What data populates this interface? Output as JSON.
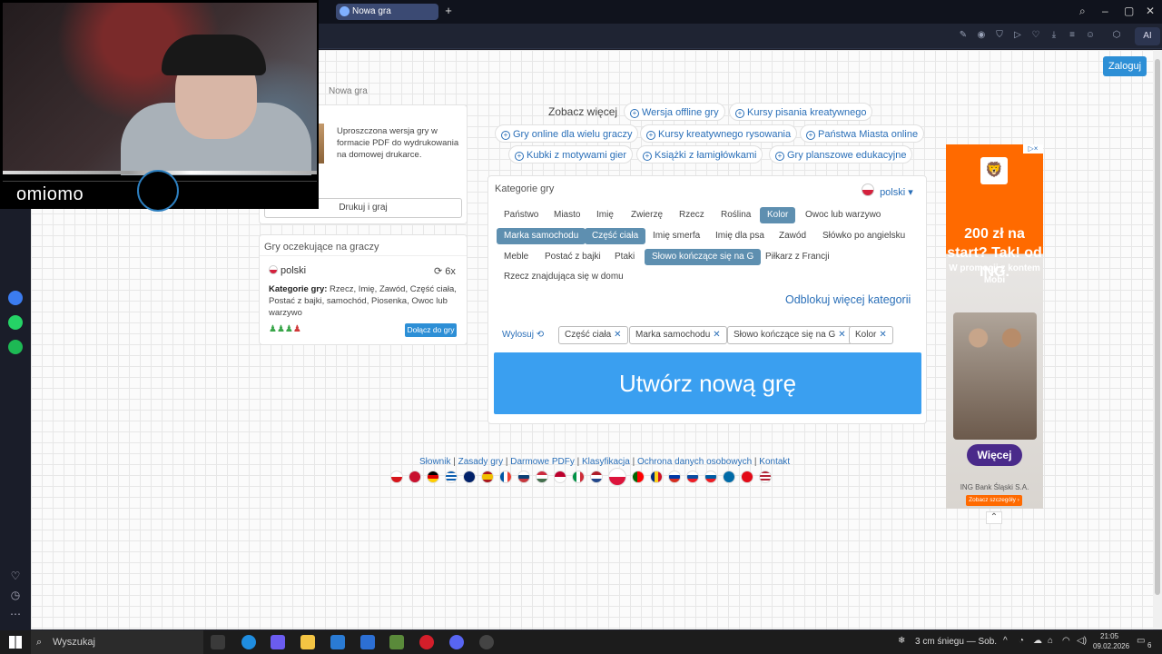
{
  "browser": {
    "tab_title": "Nowa gra",
    "newtab_symbol": "+",
    "ai_label": "AI"
  },
  "page": {
    "login_label": "Zaloguj",
    "breadcrumb": "Nowa gra",
    "print_card": {
      "text": "Uproszczona wersja gry w formacie PDF do wydrukowania na domowej drukarce.",
      "button": "Drukuj i graj"
    },
    "waiting_card": {
      "title": "Gry oczekujące na graczy",
      "language": "polski",
      "count": "6x",
      "categories_label": "Kategorie gry:",
      "categories": "Rzecz, Imię, Zawód, Część ciała, Postać z bajki, samochód, Piosenka, Owoc lub warzywo",
      "join_button": "Dołącz do gry"
    },
    "see_more_label": "Zobacz więcej",
    "links": [
      "Wersja offline gry",
      "Kursy pisania kreatywnego",
      "Gry online dla wielu graczy",
      "Kursy kreatywnego rysowania",
      "Państwa Miasta online",
      "Kubki z motywami gier",
      "Książki z łamigłówkami",
      "Gry planszowe edukacyjne"
    ],
    "categories_panel": {
      "title": "Kategorie gry",
      "language": "polski",
      "chips": [
        {
          "label": "Państwo",
          "selected": false
        },
        {
          "label": "Miasto",
          "selected": false
        },
        {
          "label": "Imię",
          "selected": false
        },
        {
          "label": "Zwierzę",
          "selected": false
        },
        {
          "label": "Rzecz",
          "selected": false
        },
        {
          "label": "Roślina",
          "selected": false
        },
        {
          "label": "Kolor",
          "selected": true
        },
        {
          "label": "Owoc lub warzywo",
          "selected": false
        },
        {
          "label": "Marka samochodu",
          "selected": true
        },
        {
          "label": "Część ciała",
          "selected": true
        },
        {
          "label": "Imię smerfa",
          "selected": false
        },
        {
          "label": "Imię dla psa",
          "selected": false
        },
        {
          "label": "Zawód",
          "selected": false
        },
        {
          "label": "Słówko po angielsku",
          "selected": false
        },
        {
          "label": "Meble",
          "selected": false
        },
        {
          "label": "Postać z bajki",
          "selected": false
        },
        {
          "label": "Ptaki",
          "selected": false
        },
        {
          "label": "Słowo kończące się na G",
          "selected": true
        },
        {
          "label": "Piłkarz z Francji",
          "selected": false
        },
        {
          "label": "Rzecz znajdująca się w domu",
          "selected": false
        }
      ],
      "unlock_label": "Odblokuj więcej kategorii",
      "draw_label": "Wylosuj",
      "selected_tags": [
        "Część ciała",
        "Marka samochodu",
        "Słowo kończące się na G",
        "Kolor"
      ],
      "create_button": "Utwórz nową grę"
    },
    "footer_links": [
      "Słownik",
      "Zasady gry",
      "Darmowe PDFy",
      "Klasyfikacja",
      "Ochrona danych osobowych",
      "Kontakt"
    ]
  },
  "ad": {
    "badge": "▷×",
    "headline": "200 zł na start? Tak! od ING.",
    "subtext": "W promocji z kontem Mobi",
    "more_button": "Więcej",
    "bank": "ING Bank Śląski S.A.",
    "details": "Zobacz szczegóły ›"
  },
  "overlay": {
    "streamer_name": "omiomo"
  },
  "taskbar": {
    "search_placeholder": "Wyszukaj",
    "weather": "3 cm śniegu — Sob.",
    "time": "21:05",
    "date": "09.02.2026",
    "notifications": "6"
  },
  "colors": {
    "accent": "#2d8fd6",
    "create_button": "#3a9ff0",
    "selected_chip": "#5e8fb0",
    "ad_orange": "#ff6a00"
  }
}
